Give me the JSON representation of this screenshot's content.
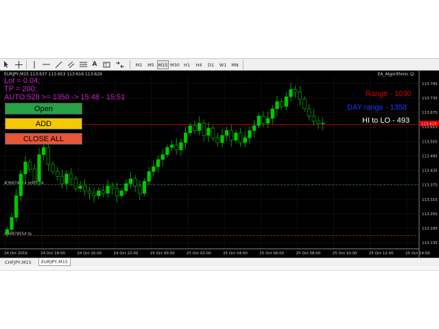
{
  "toolbar": {
    "tools": [
      "cursor-icon",
      "crosshair-icon",
      "vertical-line-icon",
      "horizontal-line-icon",
      "trendline-icon",
      "channel-icon",
      "fibonacci-icon",
      "text-icon",
      "label-icon",
      "arrows-icon"
    ],
    "timeframes": [
      "M1",
      "M5",
      "M15",
      "M30",
      "H1",
      "H4",
      "D1",
      "W1",
      "MN"
    ],
    "active_timeframe": "M15"
  },
  "chart": {
    "symbol_header": "EURJPY,M15  113.637 113.653 113.616 113.629",
    "expert_label": "EA_Algorithmic ☺",
    "info_lines": [
      "Lot = 0.04;",
      "TP = 200;",
      "AUTO:528 >= 1350 -> 15:48 - 15:51"
    ],
    "buttons": {
      "open": "Open",
      "add": "ADD",
      "close_all": "CLOSE ALL"
    },
    "right_labels": {
      "range": "Range - 1030",
      "day_range": "DAY range - 1358",
      "hi_lo": "HI to LO - 493"
    },
    "order_label_1": "#36874724 sell 0.04",
    "order_label_2": "#36878554 tp",
    "current_price": "113.629",
    "colors": {
      "bull": "#00c800",
      "bear": "#00c800",
      "info": "#d020d0",
      "open_btn": "#27a046",
      "add_btn": "#f5c800",
      "close_btn": "#e8563a",
      "range": "#e00000",
      "day_range": "#1a3cff",
      "hi_lo": "#ffffff"
    }
  },
  "tabs": [
    "CHFJPY,M15",
    "EURJPY,M15"
  ],
  "active_tab": "EURJPY,M15",
  "chart_data": {
    "type": "candlestick",
    "y_ticks": [
      "113.795",
      "113.735",
      "113.675",
      "113.615",
      "113.555",
      "113.495",
      "113.435",
      "113.375",
      "113.315",
      "113.255",
      "113.195",
      "113.135"
    ],
    "x_ticks": [
      "24 Oct 2016",
      "24 Oct 18:00",
      "24 Oct 20:00",
      "24 Oct 22:00",
      "25 Oct 00:00",
      "25 Oct 02:00",
      "25 Oct 04:00",
      "25 Oct 06:00",
      "25 Oct 08:00",
      "25 Oct 10:00",
      "25 Oct 12:00",
      "25 Oct 14:00"
    ],
    "closes": [
      113.19,
      113.24,
      113.33,
      113.42,
      113.47,
      113.44,
      113.39,
      113.5,
      113.53,
      113.46,
      113.43,
      113.41,
      113.38,
      113.42,
      113.4,
      113.36,
      113.37,
      113.35,
      113.34,
      113.33,
      113.35,
      113.34,
      113.37,
      113.36,
      113.33,
      113.35,
      113.38,
      113.4,
      113.37,
      113.34,
      113.39,
      113.43,
      113.45,
      113.48,
      113.5,
      113.53,
      113.54,
      113.52,
      113.55,
      113.59,
      113.62,
      113.6,
      113.63,
      113.58,
      113.61,
      113.57,
      113.55,
      113.58,
      113.6,
      113.56,
      113.59,
      113.55,
      113.57,
      113.6,
      113.62,
      113.66,
      113.63,
      113.65,
      113.69,
      113.72,
      113.7,
      113.74,
      113.77,
      113.76,
      113.73,
      113.69,
      113.66,
      113.64,
      113.63,
      113.63
    ]
  }
}
